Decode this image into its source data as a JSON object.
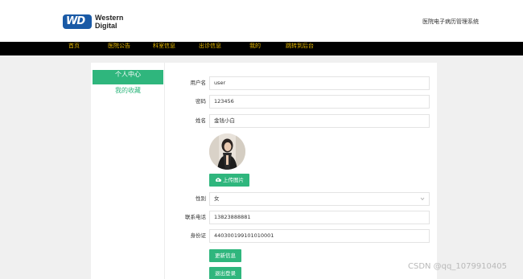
{
  "brand": {
    "badge": "WD",
    "line1": "Western",
    "line2": "Digital"
  },
  "header": {
    "system_name": "医院电子病历管理系统"
  },
  "nav": [
    "首页",
    "医院公告",
    "科室信息",
    "出诊信息",
    "我的",
    "跳转到后台"
  ],
  "sidebar": {
    "active": "个人中心",
    "favorites": "我的收藏"
  },
  "form": {
    "username": {
      "label": "用户名",
      "value": "user"
    },
    "password": {
      "label": "密码",
      "value": "123456"
    },
    "name": {
      "label": "姓名",
      "value": "金钱小白"
    },
    "upload_button": "上传图片",
    "gender": {
      "label": "性别",
      "value": "女"
    },
    "phone": {
      "label": "联系电话",
      "value": "13823888881"
    },
    "id_card": {
      "label": "身份证",
      "value": "440300199101010001"
    },
    "update_button": "更新信息",
    "logout_button": "退出登录"
  },
  "watermark": "CSDN @qq_1079910405",
  "colors": {
    "accent": "#2fb67d",
    "nav_bg": "#000000",
    "nav_text": "#e6b800",
    "brand_blue": "#1a5aa6"
  },
  "icons": {
    "upload": "cloud-upload-icon",
    "select": "chevron-down-icon"
  }
}
